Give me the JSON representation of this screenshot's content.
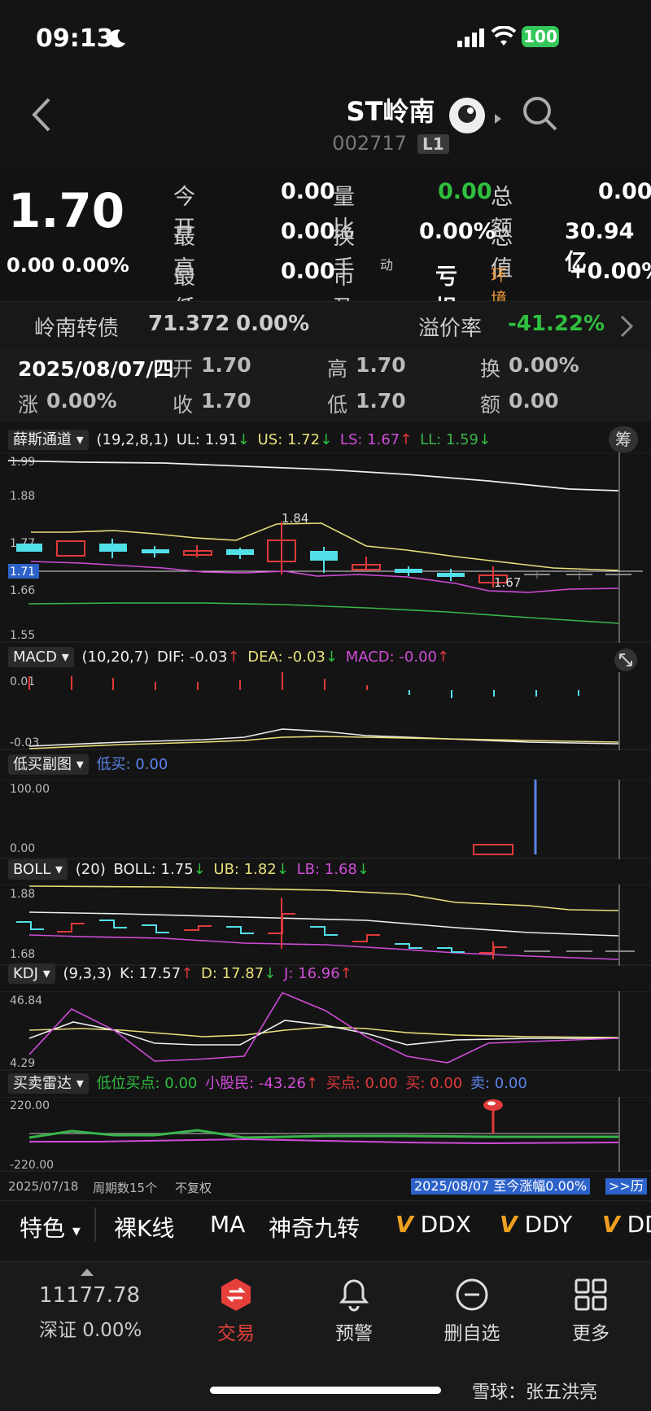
{
  "status": {
    "time": "09:13",
    "battery": "100"
  },
  "header": {
    "name": "ST岭南",
    "code": "002717",
    "level": "L1"
  },
  "quote": {
    "price": "1.70",
    "change": "0.00 0.00%",
    "grid": [
      {
        "l1": "今开",
        "v1": "0.00",
        "l2": "量比",
        "v2": "0.00",
        "l3": "总额",
        "v3": "0.00"
      },
      {
        "l1": "最高",
        "v1": "0.00",
        "l2": "换手",
        "v2": "0.00%",
        "l3": "总值",
        "v3": "30.94亿"
      },
      {
        "l1": "最低",
        "v1": "0.00",
        "l2": "市盈",
        "l2sup": "动",
        "v2": "亏损",
        "l3": "环境治理",
        "v3": "+0.00%"
      }
    ]
  },
  "bond": {
    "name": "岭南转债",
    "price": "71.372",
    "pct": "0.00%",
    "premium_label": "溢价率",
    "premium": "-41.22%"
  },
  "day": {
    "date": "2025/08/07/四",
    "open_l": "开",
    "open": "1.70",
    "high_l": "高",
    "high": "1.70",
    "turn_l": "换",
    "turn": "0.00%",
    "chg_l": "涨",
    "chg": "0.00%",
    "close_l": "收",
    "close": "1.70",
    "low_l": "低",
    "low": "1.70",
    "amt_l": "额",
    "amt": "0.00"
  },
  "panels": {
    "main": {
      "name": "薛斯通道",
      "params": "(19,2,8,1)",
      "ul": "UL: 1.91",
      "us": "US: 1.72",
      "ls": "LS: 1.67",
      "ll": "LL: 1.59",
      "ticks": [
        "1.99",
        "1.88",
        "1.77",
        "1.71",
        "1.66",
        "1.55"
      ],
      "ann_high": "1.84",
      "ann_low": "1.67",
      "btn": "筹"
    },
    "macd": {
      "name": "MACD",
      "params": "(10,20,7)",
      "dif": "DIF: -0.03",
      "dea": "DEA: -0.03",
      "macd": "MACD: -0.00",
      "ticks": [
        "0.01",
        "-0.03"
      ]
    },
    "dimai": {
      "name": "低买副图",
      "val": "低买: 0.00",
      "ticks": [
        "100.00",
        "0.00"
      ]
    },
    "boll": {
      "name": "BOLL",
      "params": "(20)",
      "boll": "BOLL: 1.75",
      "ub": "UB: 1.82",
      "lb": "LB: 1.68",
      "ticks": [
        "1.88",
        "1.68"
      ]
    },
    "kdj": {
      "name": "KDJ",
      "params": "(9,3,3)",
      "k": "K: 17.57",
      "d": "D: 17.87",
      "j": "J: 16.96",
      "ticks": [
        "46.84",
        "4.29"
      ]
    },
    "radar": {
      "name": "买卖雷达",
      "a": "低位买点: 0.00",
      "b": "小股民: -43.26",
      "c": "买点: 0.00",
      "d": "买: 0.00",
      "e": "卖: 0.00",
      "ticks": [
        "220.00",
        "-220.00"
      ]
    }
  },
  "footer_axis": {
    "start": "2025/07/18",
    "period": "周期数15个",
    "adj": "不复权",
    "range": "2025/08/07 至今涨幅0.00%",
    "hist": ">>历"
  },
  "tabs": [
    "特色",
    "裸K线",
    "MA",
    "神奇九转",
    "DDX",
    "DDY",
    "DD"
  ],
  "bottom_nav": {
    "index_value": "11177.78",
    "index_label": "深证 0.00%",
    "items": [
      "交易",
      "预警",
      "删自选",
      "更多"
    ]
  },
  "watermark": "雪球：张五洪亮",
  "colors": {
    "up": "#e03a3a",
    "down": "#52e0e8",
    "yellow": "#e8e07a",
    "magenta": "#d04cd8",
    "green": "#39b54a",
    "blue": "#5b84e8"
  }
}
